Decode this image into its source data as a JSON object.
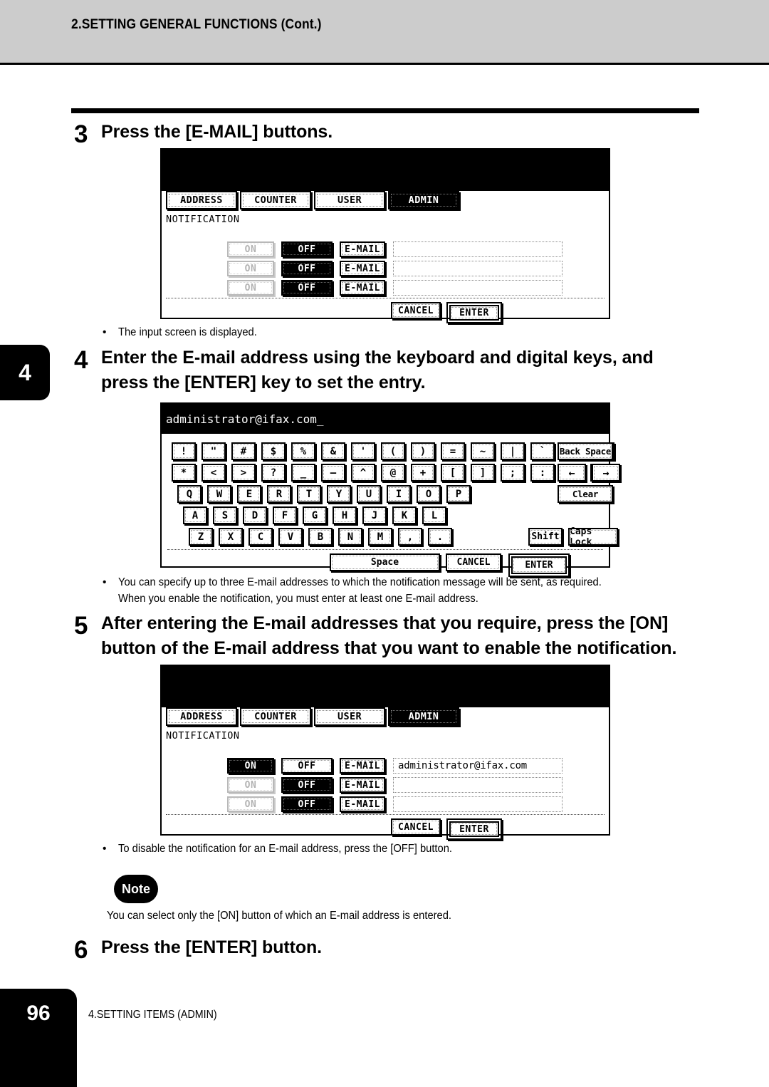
{
  "header": {
    "title": "2.SETTING GENERAL FUNCTIONS (Cont.)"
  },
  "chapter_tab": {
    "number": "4"
  },
  "footer": {
    "page_number": "96",
    "section": "4.SETTING ITEMS (ADMIN)"
  },
  "steps": [
    {
      "number": "3",
      "text": "Press the [E-MAIL] buttons."
    },
    {
      "number": "4",
      "text": "Enter the E-mail address using the keyboard and digital keys, and press the [ENTER] key to set the entry."
    },
    {
      "number": "5",
      "text": "After entering the E-mail addresses that you require, press the [ON] button of the E-mail address that you want to enable the notification."
    },
    {
      "number": "6",
      "text": "Press the [ENTER] button."
    }
  ],
  "bullets": {
    "after_step3": "The input screen is displayed.",
    "after_step4": "You can specify up to three E-mail addresses to which the notification message will be sent, as required.\nWhen you enable the notification, you must enter at least one E-mail address.",
    "after_step5": "To disable the notification for an E-mail address, press the [OFF] button."
  },
  "note": {
    "badge": "Note",
    "text": "You can select only the [ON] button of which an E-mail address is entered."
  },
  "lcd_common": {
    "tabs": [
      {
        "label": "ADDRESS",
        "selected": false
      },
      {
        "label": "COUNTER",
        "selected": false
      },
      {
        "label": "USER",
        "selected": false
      },
      {
        "label": "ADMIN",
        "selected": true
      }
    ],
    "screen_label": "NOTIFICATION",
    "on_label": "ON",
    "off_label": "OFF",
    "email_label": "E-MAIL",
    "cancel_label": "CANCEL",
    "enter_label": "ENTER"
  },
  "panel_step3": {
    "rows": [
      {
        "on_selected": false,
        "off_selected": true,
        "on_disabled": true,
        "address": ""
      },
      {
        "on_selected": false,
        "off_selected": true,
        "on_disabled": true,
        "address": ""
      },
      {
        "on_selected": false,
        "off_selected": true,
        "on_disabled": true,
        "address": ""
      }
    ]
  },
  "panel_step5": {
    "rows": [
      {
        "on_selected": true,
        "off_selected": false,
        "on_disabled": false,
        "address": "administrator@ifax.com"
      },
      {
        "on_selected": false,
        "off_selected": true,
        "on_disabled": true,
        "address": ""
      },
      {
        "on_selected": false,
        "off_selected": true,
        "on_disabled": true,
        "address": ""
      }
    ]
  },
  "keyboard": {
    "input_value": "administrator@ifax.com_",
    "row1": [
      "!",
      "\"",
      "#",
      "$",
      "%",
      "&",
      "'",
      "(",
      ")",
      "=",
      "~",
      "|",
      "`",
      "{",
      "}"
    ],
    "row2": [
      "*",
      "<",
      ">",
      "?",
      "_",
      "—",
      "^",
      "@",
      "+",
      "[",
      "]",
      ";",
      ":",
      "/",
      "\\"
    ],
    "row3": [
      "Q",
      "W",
      "E",
      "R",
      "T",
      "Y",
      "U",
      "I",
      "O",
      "P"
    ],
    "row4": [
      "A",
      "S",
      "D",
      "F",
      "G",
      "H",
      "J",
      "K",
      "L"
    ],
    "row5": [
      "Z",
      "X",
      "C",
      "V",
      "B",
      "N",
      "M",
      ",",
      "."
    ],
    "back_space": "Back Space",
    "arrow_left": "←",
    "arrow_right": "→",
    "clear": "Clear",
    "shift": "Shift",
    "caps_lock": "Caps Lock",
    "space": "Space",
    "cancel": "CANCEL",
    "enter": "ENTER"
  }
}
